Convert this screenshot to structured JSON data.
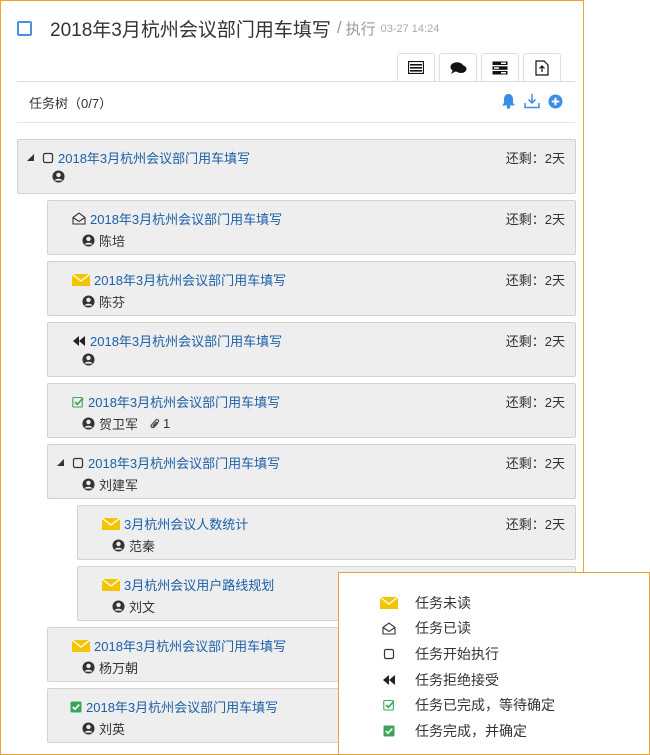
{
  "header": {
    "title": "2018年3月杭州会议部门用车填写",
    "separator": "/",
    "status": "执行",
    "timestamp": "03-27 14:24"
  },
  "tabs": [
    "list-icon",
    "chat-icon",
    "stack-icon",
    "export-icon"
  ],
  "tree": {
    "label": "任务树（0/7）",
    "tools": [
      "bell-icon",
      "download-icon",
      "add-circle-icon"
    ]
  },
  "tasks": [
    {
      "title": "2018年3月杭州会议部门用车填写",
      "remain": "还剩：2天",
      "assignee": "",
      "status_icon": "square-outline-icon",
      "collapse": true
    },
    {
      "title": "2018年3月杭州会议部门用车填写",
      "remain": "还剩：2天",
      "assignee": "陈培",
      "status_icon": "envelope-open-icon"
    },
    {
      "title": "2018年3月杭州会议部门用车填写",
      "remain": "还剩：2天",
      "assignee": "陈芬",
      "status_icon": "envelope-yellow-icon"
    },
    {
      "title": "2018年3月杭州会议部门用车填写",
      "remain": "还剩：2天",
      "assignee": "",
      "status_icon": "rewind-icon"
    },
    {
      "title": "2018年3月杭州会议部门用车填写",
      "remain": "还剩：2天",
      "assignee": "贺卫军",
      "status_icon": "check-outline-icon",
      "attachments": "1"
    },
    {
      "title": "2018年3月杭州会议部门用车填写",
      "remain": "还剩：2天",
      "assignee": "刘建军",
      "status_icon": "square-outline-icon",
      "collapse": true
    },
    {
      "title": "3月杭州会议人数统计",
      "remain": "还剩：2天",
      "assignee": "范秦",
      "status_icon": "envelope-yellow-icon"
    },
    {
      "title": "3月杭州会议用户路线规划",
      "remain": "",
      "assignee": "刘文",
      "status_icon": "envelope-yellow-icon"
    },
    {
      "title": "2018年3月杭州会议部门用车填写",
      "remain": "",
      "assignee": "杨万朝",
      "status_icon": "envelope-yellow-icon"
    },
    {
      "title": "2018年3月杭州会议部门用车填写",
      "remain": "",
      "assignee": "刘英",
      "status_icon": "check-filled-icon"
    }
  ],
  "legend": [
    {
      "icon": "envelope-yellow-icon",
      "label": "任务未读"
    },
    {
      "icon": "envelope-open-icon",
      "label": "任务已读"
    },
    {
      "icon": "square-outline-icon",
      "label": "任务开始执行"
    },
    {
      "icon": "rewind-icon",
      "label": "任务拒绝接受"
    },
    {
      "icon": "check-outline-icon",
      "label": "任务已完成，等待确定"
    },
    {
      "icon": "check-filled-icon",
      "label": "任务完成，并确定"
    }
  ],
  "colors": {
    "link": "#1a5fa8",
    "accent_border": "#f0a030",
    "card_bg": "#eeeeee",
    "brand_blue": "#4a90e2",
    "envelope": "#f5c400",
    "check": "#3aa55a"
  }
}
